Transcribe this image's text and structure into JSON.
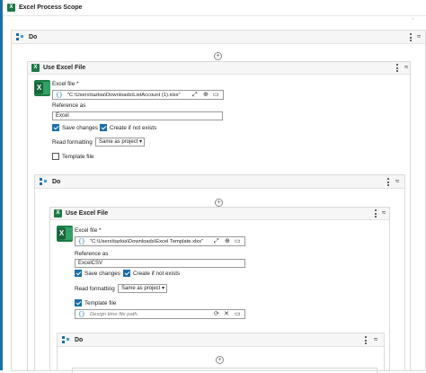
{
  "outer": {
    "title": "Excel Process Scope"
  },
  "do1": {
    "title": "Do"
  },
  "use1": {
    "title": "Use Excel File",
    "excel_file_label": "Excel file *",
    "excel_file_value": "\"C:\\Users\\tazkia\\Downloads\\ListAccount (1).xlsx\"",
    "reference_label": "Reference as",
    "reference_value": "Excel",
    "save_changes": "Save changes",
    "create_if_not_exists": "Create if not exists",
    "read_formatting_label": "Read formatting",
    "read_formatting_value": "Same as project",
    "template_file": "Template file"
  },
  "do2": {
    "title": "Do"
  },
  "use2": {
    "title": "Use Excel File",
    "excel_file_label": "Excel file *",
    "excel_file_value": "\"C:\\Users\\tazkia\\Downloads\\Excel Template.xlsx\"",
    "reference_label": "Reference as",
    "reference_value": "ExcelCSV",
    "save_changes": "Save changes",
    "create_if_not_exists": "Create if not exists",
    "read_formatting_label": "Read formatting",
    "read_formatting_value": "Same as project",
    "template_file": "Template file",
    "template_placeholder": "Design time file path."
  },
  "do3": {
    "title": "Do"
  },
  "glyphs": {
    "braces": "{}",
    "plus": "+",
    "chevron_up": "︿",
    "double_chevron_up": "≈",
    "dropdown": "▾",
    "refresh": "⟳",
    "clear": "✕"
  },
  "colors": {
    "accent": "#1a6fa8",
    "excel_green": "#1d7a45"
  }
}
